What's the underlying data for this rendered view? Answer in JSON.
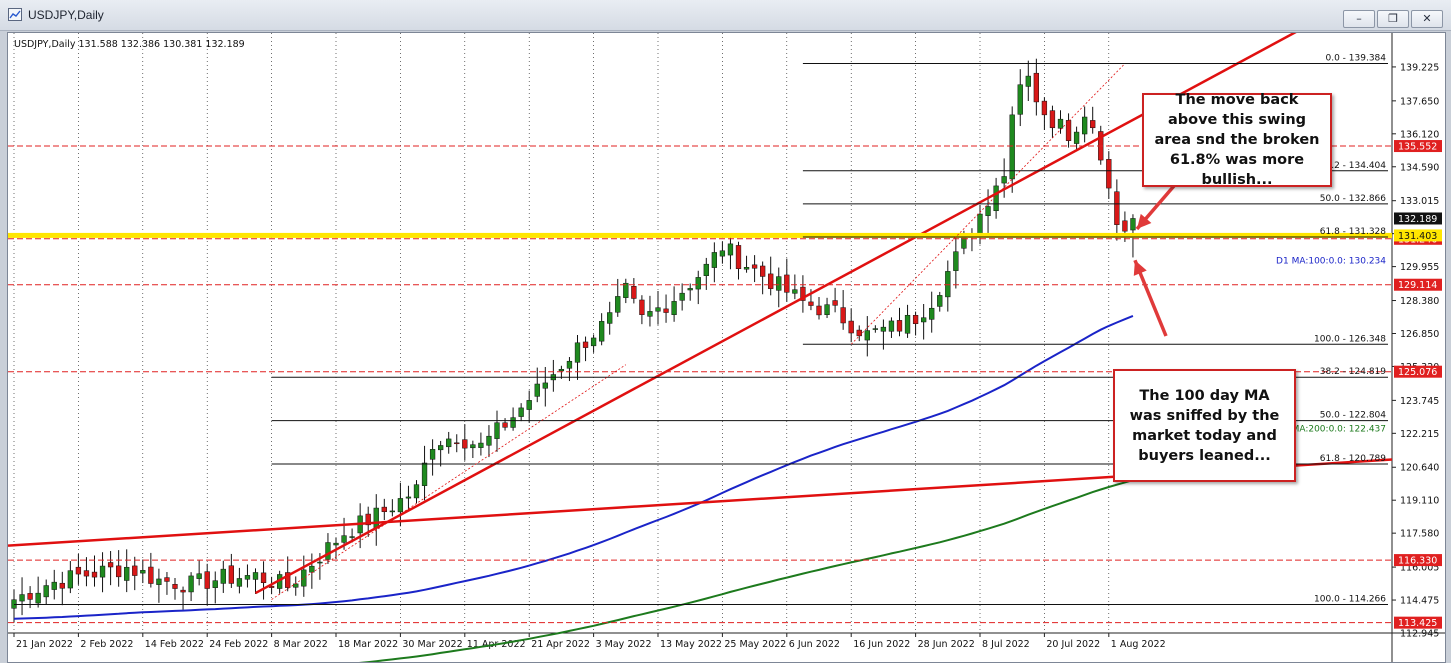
{
  "window": {
    "title": "USDJPY,Daily",
    "buttons": {
      "minimize": "–",
      "restore": "❐",
      "close": "✕"
    }
  },
  "chart_data": {
    "type": "candlestick",
    "info_line": "USDJPY,Daily  131.588 132.386 130.381 132.189",
    "ylim": [
      112.945,
      140.8
    ],
    "y_ticks": [
      "139.225",
      "137.650",
      "136.120",
      "134.590",
      "133.015",
      "131.485",
      "129.955",
      "128.380",
      "126.850",
      "125.320",
      "123.745",
      "122.215",
      "120.640",
      "119.110",
      "117.580",
      "116.005",
      "114.475",
      "112.945"
    ],
    "x_ticks": [
      "21 Jan 2022",
      "2 Feb 2022",
      "14 Feb 2022",
      "24 Feb 2022",
      "8 Mar 2022",
      "18 Mar 2022",
      "30 Mar 2022",
      "11 Apr 2022",
      "21 Apr 2022",
      "3 May 2022",
      "13 May 2022",
      "25 May 2022",
      "6 Jun 2022",
      "16 Jun 2022",
      "28 Jun 2022",
      "8 Jul 2022",
      "20 Jul 2022",
      "1 Aug 2022"
    ],
    "n_bars": 140,
    "last_close": 132.189,
    "colors": {
      "up_body": "#1f8a1f",
      "down_body": "#d81818",
      "wick": "#111111",
      "ma100": "#1a24c8",
      "ma200": "#1d7a1d",
      "trend": "#e01010",
      "support_yellow": "#ffe600",
      "level_red": "#e02020"
    },
    "horizontal_levels": [
      {
        "value": 135.552,
        "label": "135.552",
        "style": "red-dashed"
      },
      {
        "value": 131.246,
        "label": "131.246",
        "style": "red-dashed"
      },
      {
        "value": 131.403,
        "label": "131.403",
        "style": "yellow"
      },
      {
        "value": 129.114,
        "label": "129.114",
        "style": "red-dashed"
      },
      {
        "value": 125.076,
        "label": "125.076",
        "style": "red-dashed"
      },
      {
        "value": 116.33,
        "label": "116.330",
        "style": "red-dashed"
      },
      {
        "value": 113.425,
        "label": "113.425",
        "style": "red-dashed"
      }
    ],
    "fibo_sets": [
      {
        "start_bar": 98,
        "end_bar": 140,
        "levels": [
          {
            "value": 139.384,
            "label": "0.0 - 139.384"
          },
          {
            "value": 134.404,
            "label": "38.2 - 134.404"
          },
          {
            "value": 132.866,
            "label": "50.0 - 132.866"
          },
          {
            "value": 131.328,
            "label": "61.8 - 131.328"
          },
          {
            "value": 126.348,
            "label": "100.0 - 126.348"
          }
        ]
      },
      {
        "start_bar": 32,
        "end_bar": 140,
        "levels": [
          {
            "value": 124.819,
            "label": "38.2 - 124.819"
          },
          {
            "value": 122.804,
            "label": "50.0 - 122.804"
          },
          {
            "value": 120.789,
            "label": "61.8 - 120.789"
          }
        ]
      },
      {
        "start_bar": 0,
        "end_bar": 140,
        "levels": [
          {
            "value": 114.266,
            "label": "100.0 - 114.266"
          }
        ]
      }
    ],
    "ma_labels": [
      {
        "text": "D1 MA:100:0.0: 130.234",
        "value": 130.234,
        "color": "#1a24c8"
      },
      {
        "text": "D1 MA:200:0.0: 122.437",
        "value": 122.437,
        "color": "#1d7a1d"
      }
    ]
  },
  "annotations": {
    "callout_1": "The move back above this swing area snd the broken 61.8% was more bullish...",
    "callout_2": "The 100 day MA was sniffed by the market today and buyers leaned..."
  }
}
